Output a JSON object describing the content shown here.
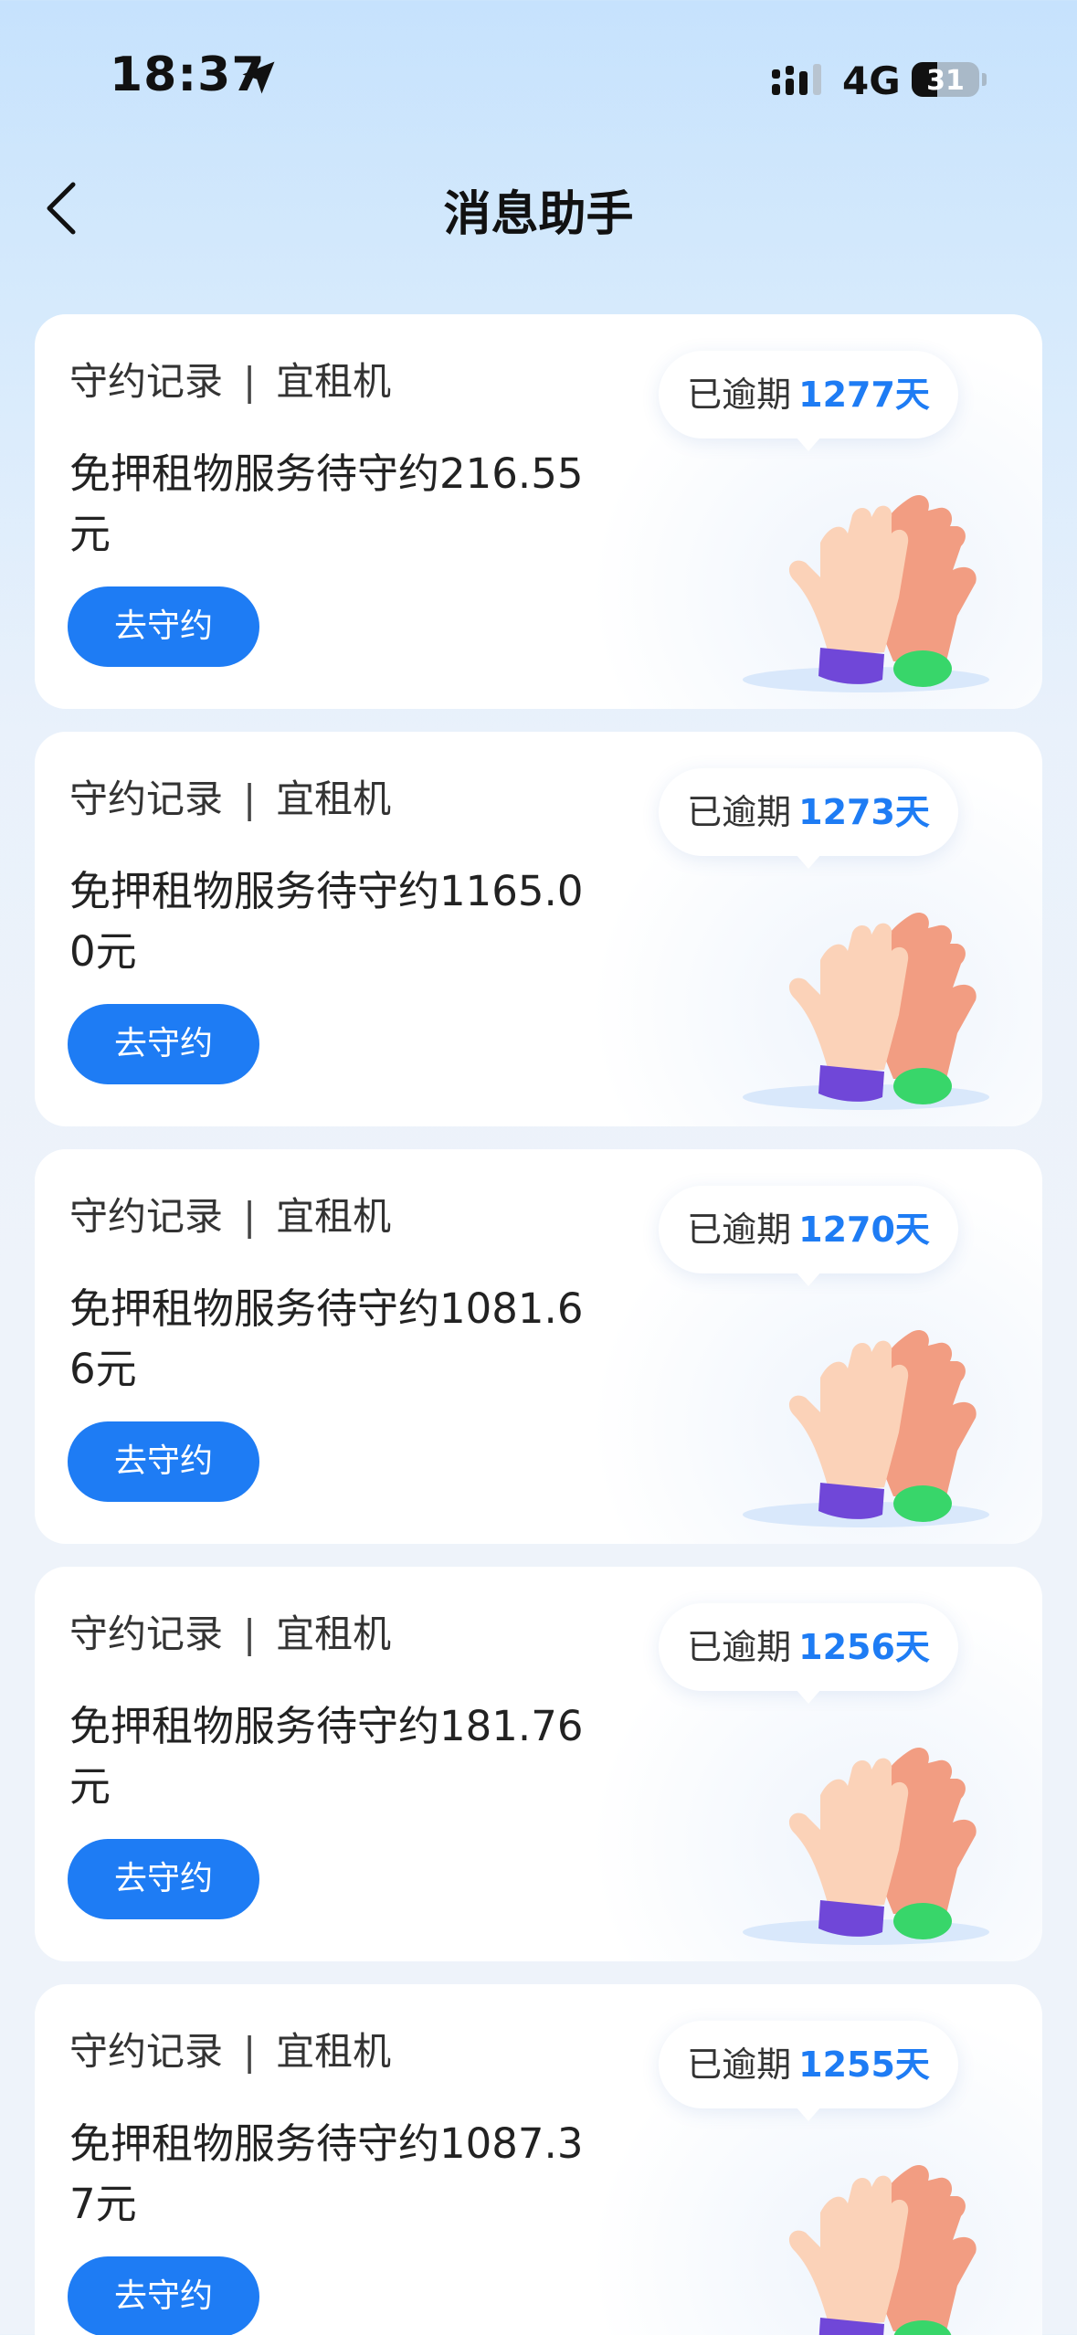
{
  "status_bar": {
    "time": "18:37",
    "network": "4G",
    "battery": "31"
  },
  "nav": {
    "title": "消息助手"
  },
  "cards": [
    {
      "category": "守约记录",
      "separator": "|",
      "merchant": "宜租机",
      "message": "免押租物服务待守约216.55元",
      "button_label": "去守约",
      "overdue_label": "已逾期",
      "overdue_days": "1277天"
    },
    {
      "category": "守约记录",
      "separator": "|",
      "merchant": "宜租机",
      "message": "免押租物服务待守约1165.00元",
      "button_label": "去守约",
      "overdue_label": "已逾期",
      "overdue_days": "1273天"
    },
    {
      "category": "守约记录",
      "separator": "|",
      "merchant": "宜租机",
      "message": "免押租物服务待守约1081.66元",
      "button_label": "去守约",
      "overdue_label": "已逾期",
      "overdue_days": "1270天"
    },
    {
      "category": "守约记录",
      "separator": "|",
      "merchant": "宜租机",
      "message": "免押租物服务待守约181.76元",
      "button_label": "去守约",
      "overdue_label": "已逾期",
      "overdue_days": "1256天"
    },
    {
      "category": "守约记录",
      "separator": "|",
      "merchant": "宜租机",
      "message": "免押租物服务待守约1087.37元",
      "button_label": "去守约",
      "overdue_label": "已逾期",
      "overdue_days": "1255天"
    }
  ],
  "icons": {
    "back": "chevron-left-icon",
    "location": "location-arrow-icon",
    "signal": "cellular-signal-icon",
    "illustration": "high-five-hands-icon"
  },
  "colors": {
    "accent": "#1e7cf4",
    "background_top": "#c6e2fd",
    "card": "#ffffff"
  }
}
